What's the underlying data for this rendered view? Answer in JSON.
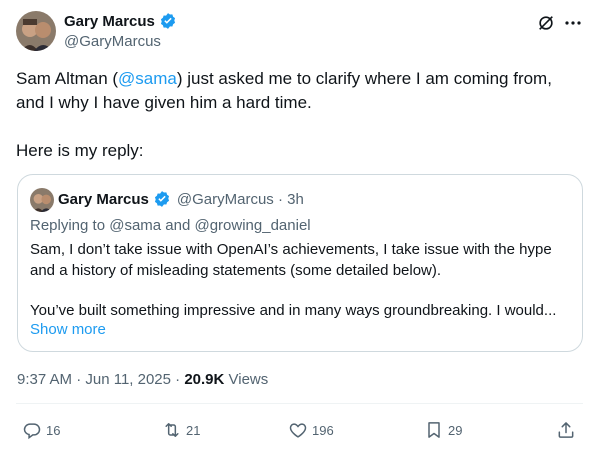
{
  "author": {
    "name": "Gary Marcus",
    "handle": "@GaryMarcus",
    "verified": true
  },
  "header_icons": [
    "grok-icon",
    "more-icon"
  ],
  "tweet": {
    "line1_pre": "Sam Altman (",
    "mention": "@sama",
    "line1_post": ") just asked me to clarify where I am coming from,",
    "line2": "and I why I have given him a hard time.",
    "line3": "Here is my reply:"
  },
  "quote": {
    "name": "Gary Marcus",
    "handle_time": "@GaryMarcus · 3h",
    "replying_to": "Replying to @sama and @growing_daniel",
    "body_line1": "Sam, I don’t take issue with OpenAI’s achievements, I take issue with the hype",
    "body_line2": "and a history of  misleading statements (some detailed below).",
    "body_line3": "You’ve built something impressive and in many ways groundbreaking. I would...",
    "show_more": "Show more"
  },
  "meta": {
    "time_date": "9:37 AM · Jun 11, 2025 · ",
    "views_count": "20.9K",
    "views_label": " Views"
  },
  "actions": {
    "replies": "16",
    "reposts": "21",
    "likes": "196",
    "bookmarks": "29"
  },
  "colors": {
    "link": "#1d9bf0",
    "secondary_text": "#536471",
    "verified": "#1d9bf0",
    "border": "#cfd9de"
  }
}
